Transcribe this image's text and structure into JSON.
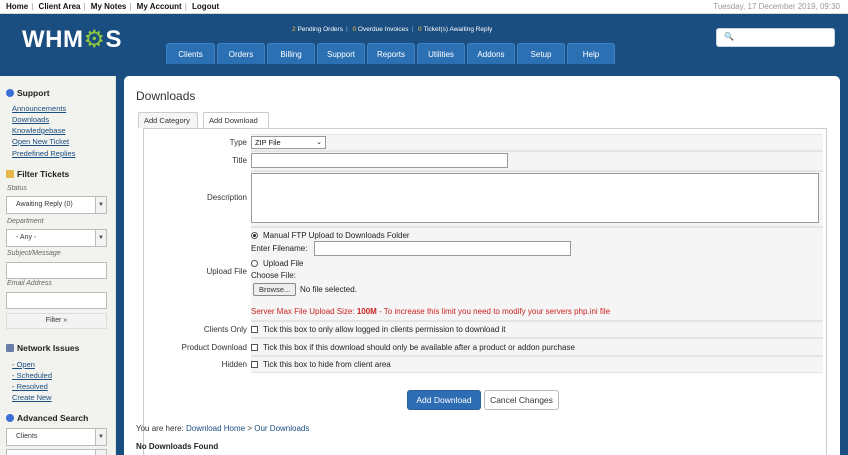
{
  "topbar": {
    "links": [
      "Home",
      "Client Area",
      "My Notes",
      "My Account",
      "Logout"
    ],
    "date": "Tuesday, 17 December 2019, 09:30"
  },
  "logo": {
    "text_a": "WHM",
    "text_b": "S"
  },
  "stats": {
    "pending_orders": "2",
    "pending_orders_label": "Pending Orders",
    "overdue": "0",
    "overdue_label": "Overdue Invoices",
    "tickets": "0",
    "tickets_label": "Ticket(s) Awaiting Reply"
  },
  "nav": [
    "Clients",
    "Orders",
    "Billing",
    "Support",
    "Reports",
    "Utilities",
    "Addons",
    "Setup",
    "Help"
  ],
  "sidebar": {
    "support": {
      "title": "Support",
      "links": [
        "Announcements",
        "Downloads",
        "Knowledgebase",
        "Open New Ticket",
        "Predefined Replies"
      ]
    },
    "filter": {
      "title": "Filter Tickets",
      "status_label": "Status",
      "status_value": "Awaiting Reply (0)",
      "department_label": "Department",
      "department_value": "- Any -",
      "subject_label": "Subject/Message",
      "email_label": "Email Address",
      "button": "Filter »"
    },
    "network": {
      "title": "Network Issues",
      "links": [
        "- Open",
        "- Scheduled",
        "- Resolved",
        "Create New"
      ]
    },
    "advanced": {
      "title": "Advanced Search",
      "select_value": "Clients"
    }
  },
  "page": {
    "title": "Downloads",
    "tabs": [
      "Add Category",
      "Add Download"
    ]
  },
  "form": {
    "type_label": "Type",
    "type_value": "ZIP File",
    "title_label": "Title",
    "description_label": "Description",
    "upload_label": "Upload File",
    "opt_ftp": "Manual FTP Upload to Downloads Folder",
    "enter_filename": "Enter Filename:",
    "opt_upload": "Upload File",
    "choose_file": "Choose File:",
    "browse": "Browse...",
    "no_file": "No file selected.",
    "max_size_prefix": "Server Max File Upload Size: ",
    "max_size_value": "100M",
    "max_size_suffix": " - To increase this limit you need to modify your servers php.ini file",
    "clients_only_label": "Clients Only",
    "clients_only_text": "Tick this box to only allow logged in clients permission to download it",
    "product_label": "Product Download",
    "product_text": "Tick this box if this download should only be available after a product or addon purchase",
    "hidden_label": "Hidden",
    "hidden_text": "Tick this box to hide from client area"
  },
  "buttons": {
    "add": "Add Download",
    "cancel": "Cancel Changes"
  },
  "breadcrumb": {
    "prefix": "You are here: ",
    "home": "Download Home",
    "sep": " > ",
    "current": "Our Downloads"
  },
  "empty": "No Downloads Found",
  "colors": {
    "header": "#1a4d80",
    "nav": "#2c70b4",
    "accent": "#8dc63f",
    "warning": "#cc2222"
  }
}
